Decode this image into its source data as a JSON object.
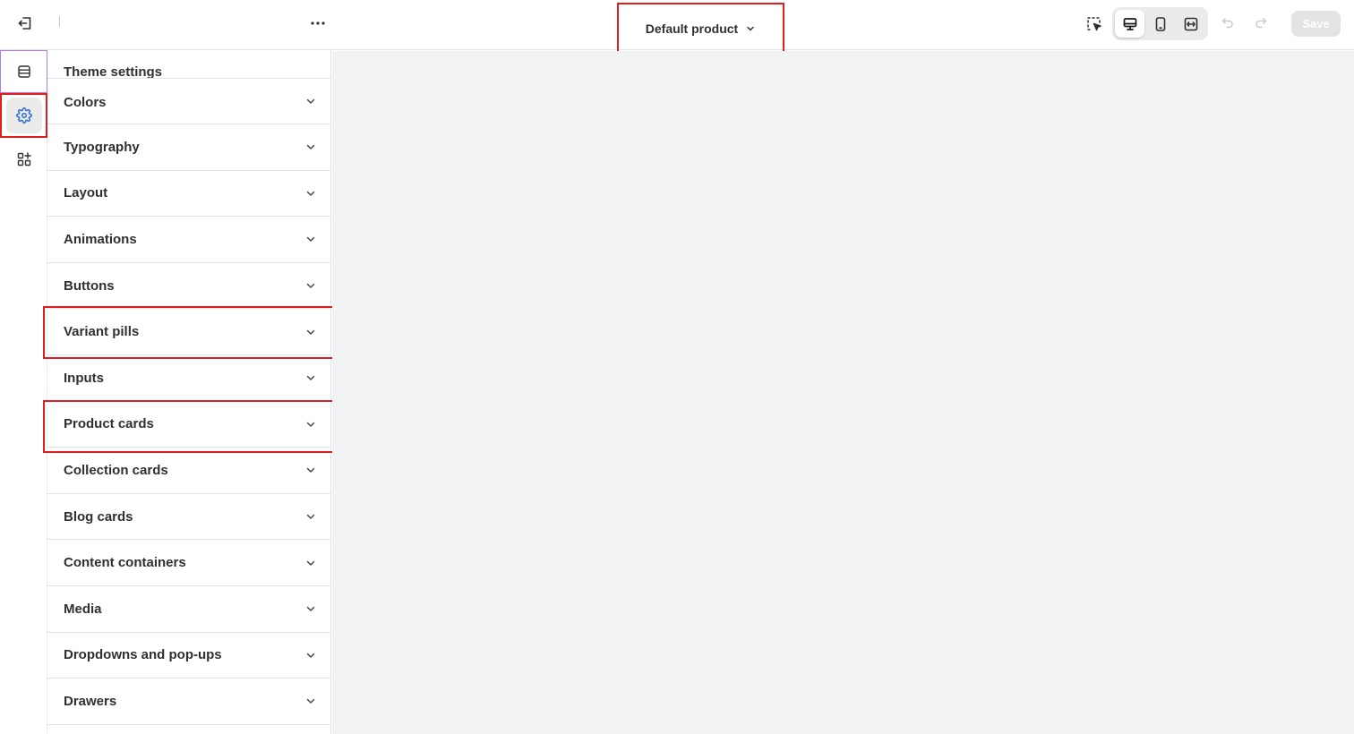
{
  "topbar": {
    "exit_icon": "exit-icon",
    "more_icon": "more-horizontal-icon",
    "template_selector": {
      "label": "Default product",
      "icon": "chevron-down-icon"
    },
    "inspector_icon": "inspector-cursor-icon",
    "viewports": [
      {
        "name": "desktop",
        "icon": "desktop-icon",
        "active": true
      },
      {
        "name": "mobile",
        "icon": "mobile-icon",
        "active": false
      },
      {
        "name": "full-width",
        "icon": "fullscreen-icon",
        "active": false
      }
    ],
    "undo_icon": "undo-icon",
    "redo_icon": "redo-icon",
    "save_label": "Save"
  },
  "rail": {
    "items": [
      {
        "name": "sections",
        "icon": "sections-icon"
      },
      {
        "name": "theme-settings",
        "icon": "gear-icon",
        "active": true
      },
      {
        "name": "apps",
        "icon": "apps-icon"
      }
    ]
  },
  "sidebar": {
    "title": "Theme settings",
    "items": [
      {
        "label": "Colors"
      },
      {
        "label": "Typography"
      },
      {
        "label": "Layout"
      },
      {
        "label": "Animations"
      },
      {
        "label": "Buttons"
      },
      {
        "label": "Variant pills"
      },
      {
        "label": "Inputs"
      },
      {
        "label": "Product cards"
      },
      {
        "label": "Collection cards"
      },
      {
        "label": "Blog cards"
      },
      {
        "label": "Content containers"
      },
      {
        "label": "Media"
      },
      {
        "label": "Dropdowns and pop-ups"
      },
      {
        "label": "Drawers"
      }
    ]
  },
  "colors": {
    "accent_blue": "#2c6ecb",
    "highlight_red": "#e01e1e",
    "highlight_purple": "#b27cf0",
    "canvas_bg": "#f1f2f4"
  }
}
